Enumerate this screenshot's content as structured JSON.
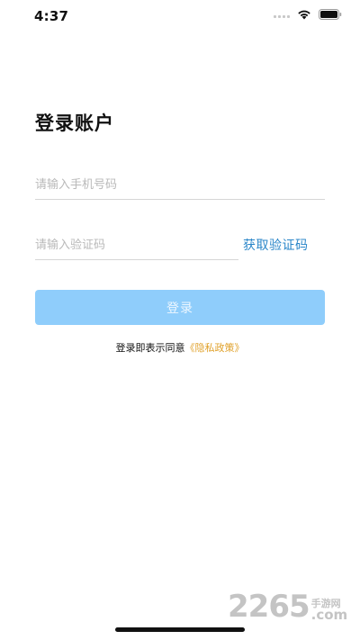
{
  "status_bar": {
    "time": "4:37"
  },
  "login": {
    "title": "登录账户",
    "phone_placeholder": "请输入手机号码",
    "code_placeholder": "请输入验证码",
    "get_code_label": "获取验证码",
    "submit_label": "登录",
    "agreement_prefix": "登录即表示同意",
    "privacy_link": "《隐私政策》"
  },
  "watermark": {
    "number": "2265",
    "cn": "手游网",
    "domain": ".com"
  },
  "colors": {
    "accent_blue": "#2a86c9",
    "button_blue": "#8fcdfb",
    "link_orange": "#e0a12a"
  }
}
